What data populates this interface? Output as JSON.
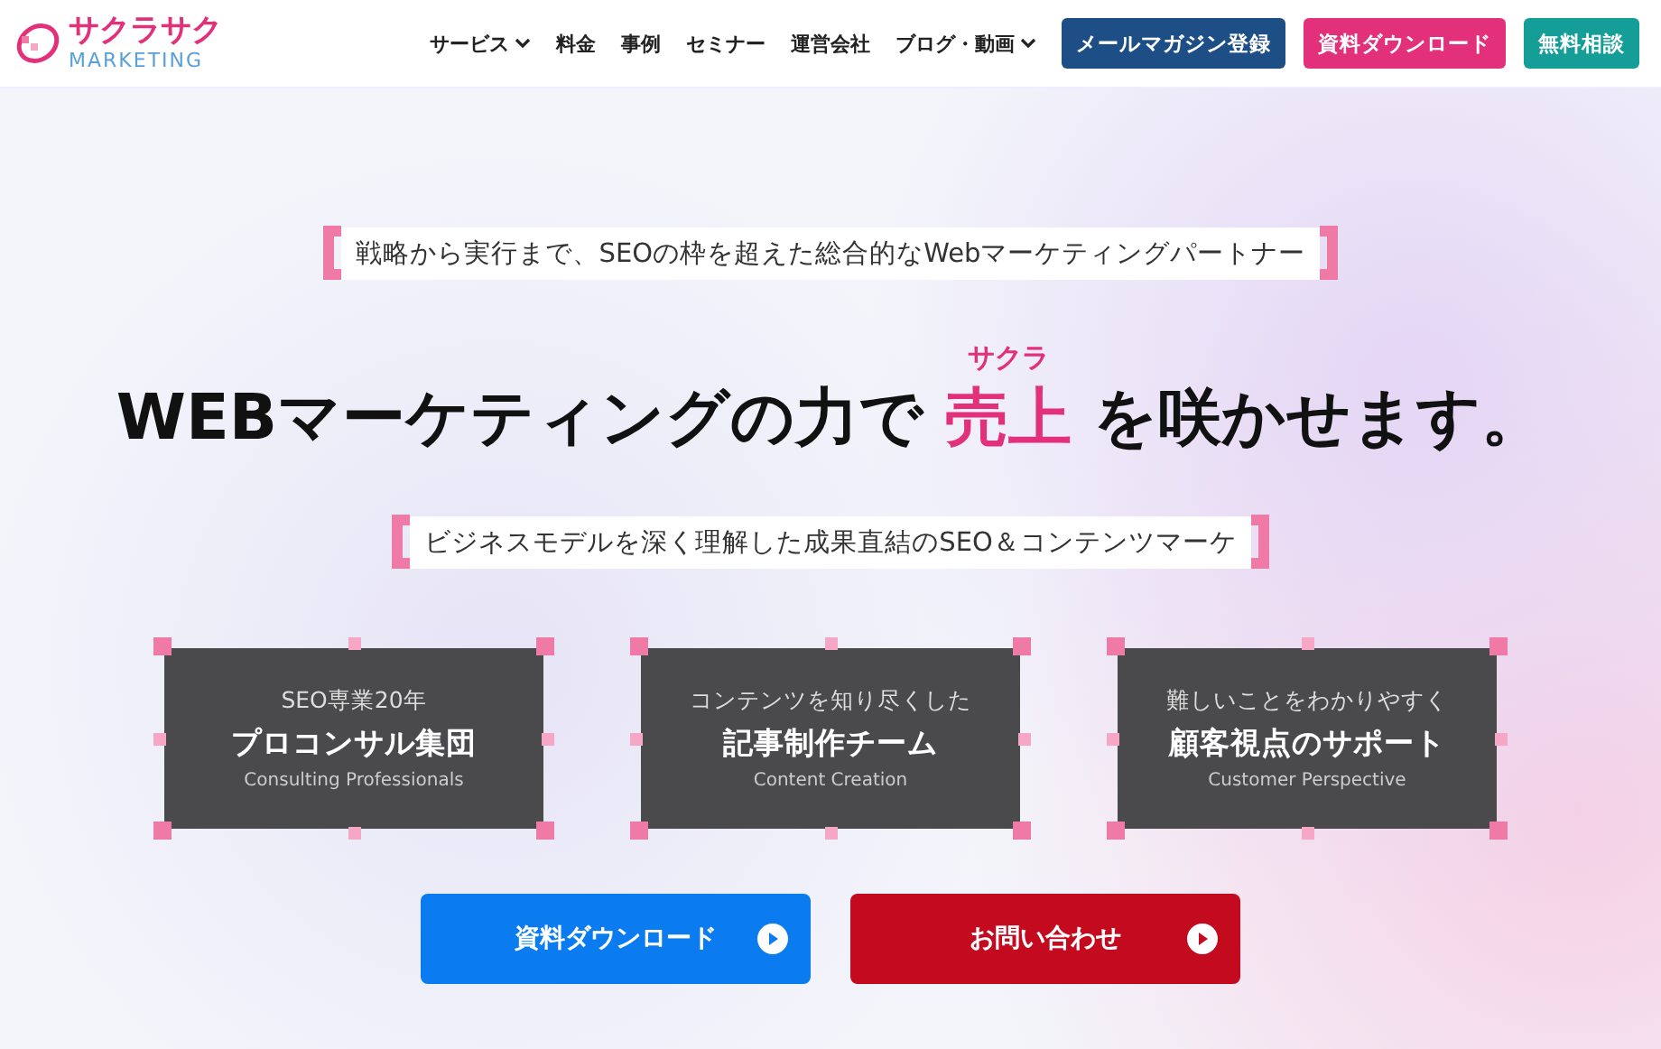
{
  "header": {
    "logo": {
      "name": "サクラサク",
      "sub": "MARKETING"
    },
    "nav": [
      {
        "label": "サービス",
        "kind": "dropdown"
      },
      {
        "label": "料金",
        "kind": "link"
      },
      {
        "label": "事例",
        "kind": "link"
      },
      {
        "label": "セミナー",
        "kind": "link"
      },
      {
        "label": "運営会社",
        "kind": "link"
      },
      {
        "label": "ブログ・動画",
        "kind": "dropdown"
      }
    ],
    "buttons": [
      {
        "label": "メールマガジン登録",
        "color": "#1d4e85"
      },
      {
        "label": "資料ダウンロード",
        "color": "#e3307a"
      },
      {
        "label": "無料相談",
        "color": "#159e98"
      }
    ]
  },
  "hero": {
    "tagline": "戦略から実行まで、SEOの枠を超えた総合的なWebマーケティングパートナー",
    "headline": {
      "before": "WEBマーケティングの力で",
      "highlight": "売上",
      "ruby": "サクラ",
      "after": "を咲かせます。"
    },
    "subline": "ビジネスモデルを深く理解した成果直結のSEO＆コンテンツマーケ",
    "cards": [
      {
        "top": "SEO専業20年",
        "title": "プロコンサル集団",
        "english": "Consulting Professionals"
      },
      {
        "top": "コンテンツを知り尽くした",
        "title": "記事制作チーム",
        "english": "Content Creation"
      },
      {
        "top": "難しいことをわかりやすく",
        "title": "顧客視点のサポート",
        "english": "Customer Perspective"
      }
    ],
    "cta": [
      {
        "label": "資料ダウンロード",
        "color": "#0a7cf0"
      },
      {
        "label": "お問い合わせ",
        "color": "#c30a1f"
      }
    ]
  }
}
